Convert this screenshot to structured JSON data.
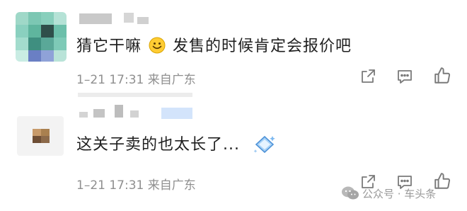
{
  "comments": [
    {
      "text_a": "猜它干嘛",
      "emoji": "smiley-emoji",
      "text_b": "发售的时候肯定会报价吧",
      "meta": "1–21 17:31 来自广东"
    },
    {
      "text": "这关子卖的也太长了...",
      "emoji": "diamond-sparkle-emoji",
      "meta": "1–21 17:31 来自广东"
    }
  ],
  "actions": [
    "share-icon",
    "comment-icon",
    "like-icon"
  ],
  "watermark": "公众号 · 车头条"
}
